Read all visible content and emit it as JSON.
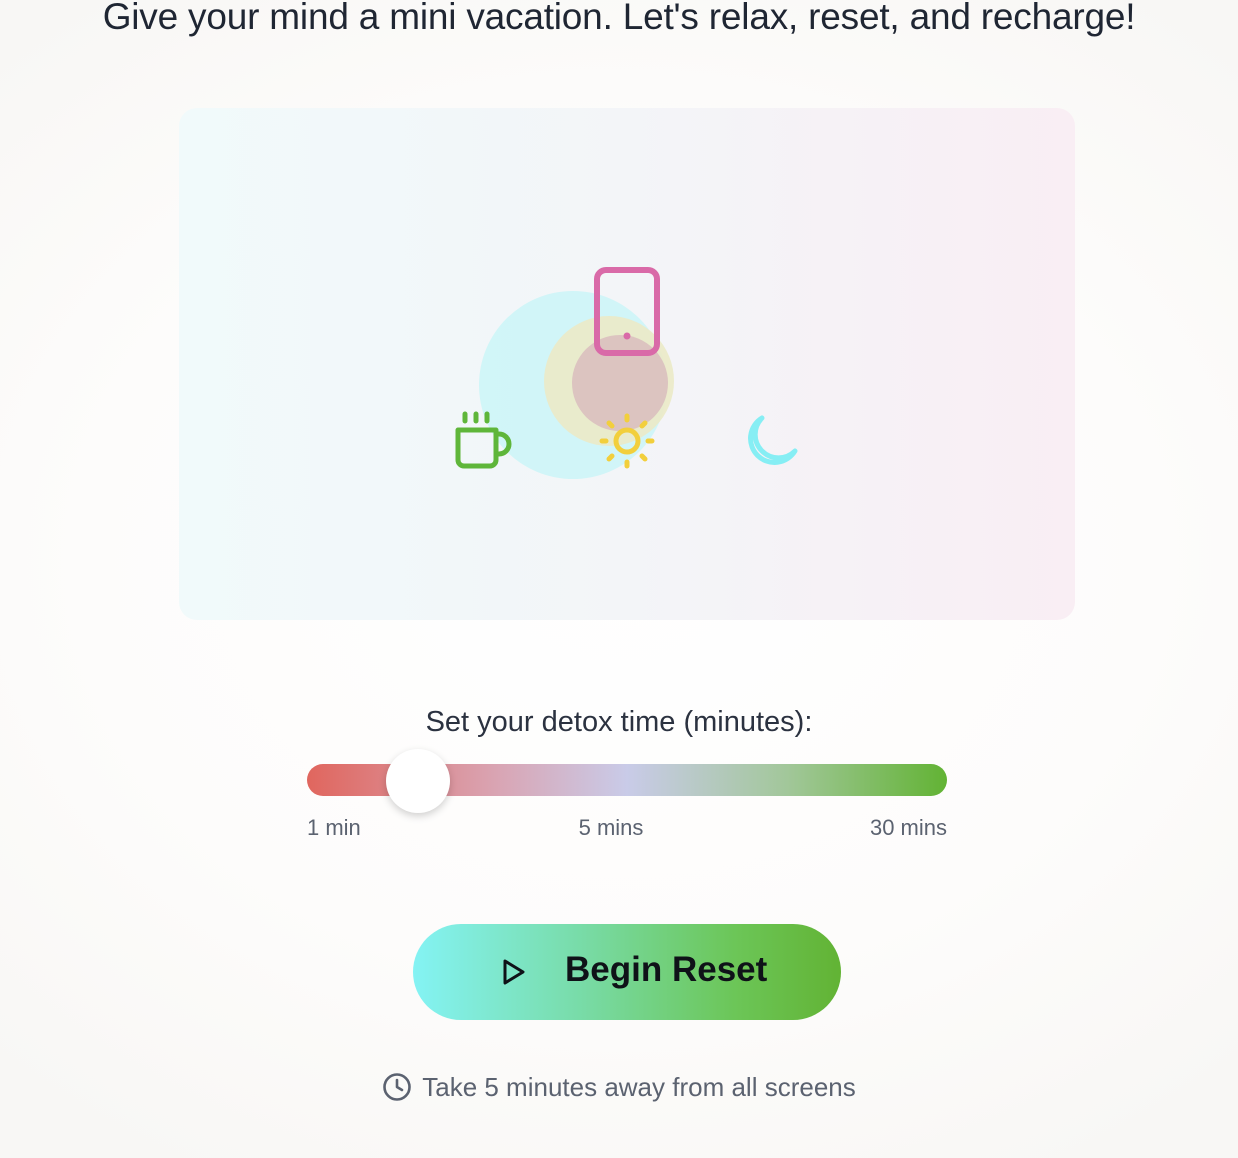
{
  "header": {
    "headline": "Give your mind a mini vacation. Let's relax, reset, and recharge!"
  },
  "scene": {
    "icons": [
      "phone-icon",
      "coffee-cup-icon",
      "sun-icon",
      "moon-icon"
    ],
    "colors": {
      "phone": "#d96aa8",
      "coffee": "#5fb63a",
      "sun": "#f2cf3c",
      "moon": "#86eef4",
      "glow_cyan": "#cdf5f7"
    }
  },
  "timer": {
    "label": "Set your detox time (minutes):",
    "tick_min": "1 min",
    "tick_mid": "5 mins",
    "tick_max": "30 mins",
    "selected_minutes": 5
  },
  "actions": {
    "begin_label": "Begin Reset"
  },
  "footer": {
    "note": "Take 5 minutes away from all screens"
  }
}
